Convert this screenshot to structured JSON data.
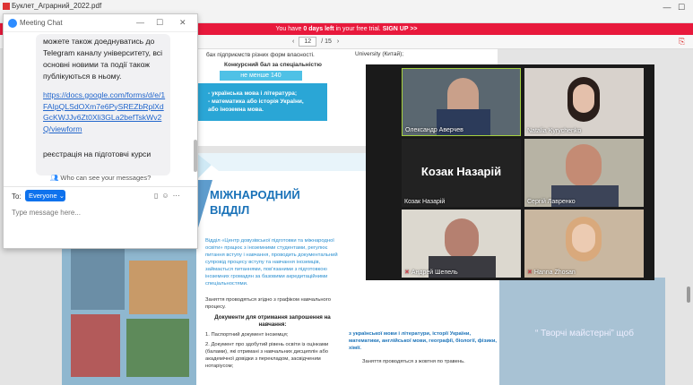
{
  "pdf_viewer": {
    "file_title": "Буклет_Аграрний_2022.pdf",
    "trial_text_pre": "You have ",
    "trial_days": "0 days left",
    "trial_text_post": " in your free trial.",
    "trial_link": "SIGN UP >>",
    "current_page": "12",
    "page_total": "/ 15"
  },
  "page_content": {
    "fragment_top": "бах підприємств різних форм власності.",
    "competitive_score_heading": "Конкурсний бал за спеціальністю",
    "min_score": "не менше 140",
    "subjects_line1": "- українська мова і література;",
    "subjects_line2": "- математика або історія України,",
    "subjects_line3": "або іноземна мова.",
    "right_fragment": "University (Китай);",
    "international_title_1": "МІЖНАРОДНИЙ",
    "international_title_2": "ВІДДІЛ",
    "body_intro": "Відділ «Центр довузівської підготовки та міжнародної освіти» працює з іноземними студентами, регулює питання вступу і навчання, проводить документальний супровід процесу вступу та навчання іноземців, займається питаннями, пов'язаними з підготовкою іноземних громадян за базовими акредитаційними спеціальностями.",
    "schedule_note": "Заняття проводяться згідно з графіком навчального процесу.",
    "docs_heading": "Документи для отримання запрошення на навчання:",
    "doc_1": "1. Паспортний документ іноземця;",
    "doc_2": "2. Документ про здобутий рівень освіти із оцінками (балами), які отримані з навчальних дисциплін або академічної довідки з перекладом, засвідченим нотаріусом;",
    "right_bottom_1": "з української мови і літератури, історії України, математики, англійської мови, географії, біології, фізики, хімії.",
    "right_bottom_2": "Заняття проводяться з жовтня по травень.",
    "watermark": "“ Творчі майстерні” щоб"
  },
  "chat": {
    "title": "Meeting Chat",
    "message_text": "можете також доеднуватись до Telegram каналу університету, всі основні новими та події також публікуються в ньому.",
    "link": "https://docs.google.com/forms/d/e/1FAIpQLSdOXm7e6PySREZbRplXdGcKWJJv6Zt0Xli3GLa2befTskWv2Q/viewform",
    "message_text_2": "реєстрація на підготовчі курси",
    "who_can_see": "Who can see your messages?",
    "to_label": "To:",
    "recipient": "Everyone",
    "input_placeholder": "Type message here..."
  },
  "participants": [
    {
      "name": "Олександр Аверчев"
    },
    {
      "name": "Natalia Kyrychenko"
    },
    {
      "name": "Козак Назарій",
      "big_label": "Козак Назарій"
    },
    {
      "name": "Сергій Лавренко"
    },
    {
      "name": "Андрей Шепель"
    },
    {
      "name": "Hanna Zhosan"
    }
  ]
}
